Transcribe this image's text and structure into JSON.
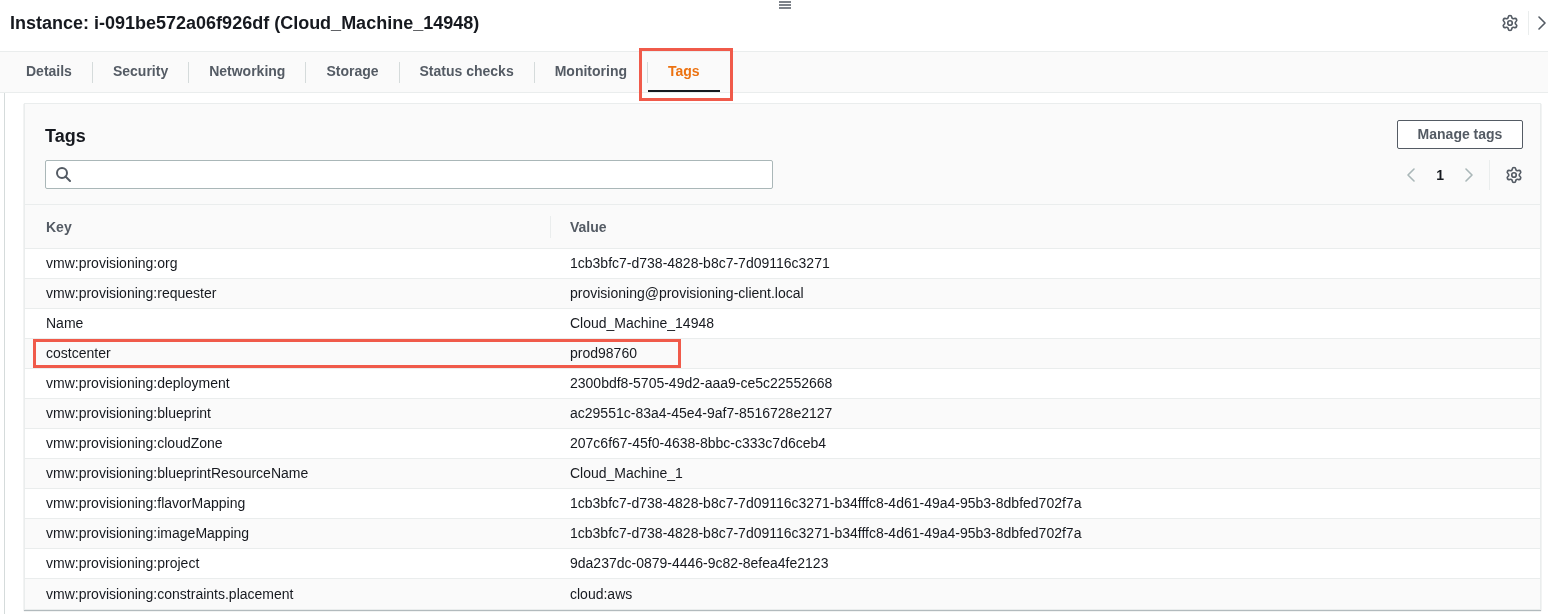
{
  "drawer": {
    "title": "Instance: i-091be572a06f926df (Cloud_Machine_14948)"
  },
  "tabs": [
    {
      "label": "Details",
      "selected": false,
      "highlighted": false
    },
    {
      "label": "Security",
      "selected": false,
      "highlighted": false
    },
    {
      "label": "Networking",
      "selected": false,
      "highlighted": false
    },
    {
      "label": "Storage",
      "selected": false,
      "highlighted": false
    },
    {
      "label": "Status checks",
      "selected": false,
      "highlighted": false
    },
    {
      "label": "Monitoring",
      "selected": false,
      "highlighted": false
    },
    {
      "label": "Tags",
      "selected": true,
      "highlighted": true
    }
  ],
  "tags_panel": {
    "title": "Tags",
    "manage_button": "Manage tags",
    "pagination": {
      "page": "1",
      "previous_disabled": true,
      "next_disabled": true
    },
    "table": {
      "columns": [
        "Key",
        "Value"
      ],
      "rows": [
        {
          "key": "vmw:provisioning:org",
          "value": "1cb3bfc7-d738-4828-b8c7-7d09116c3271",
          "highlighted": false
        },
        {
          "key": "vmw:provisioning:requester",
          "value": "provisioning@provisioning-client.local",
          "highlighted": false
        },
        {
          "key": "Name",
          "value": "Cloud_Machine_14948",
          "highlighted": false
        },
        {
          "key": "costcenter",
          "value": "prod98760",
          "highlighted": true
        },
        {
          "key": "vmw:provisioning:deployment",
          "value": "2300bdf8-5705-49d2-aaa9-ce5c22552668",
          "highlighted": false
        },
        {
          "key": "vmw:provisioning:blueprint",
          "value": "ac29551c-83a4-45e4-9af7-8516728e2127",
          "highlighted": false
        },
        {
          "key": "vmw:provisioning:cloudZone",
          "value": "207c6f67-45f0-4638-8bbc-c333c7d6ceb4",
          "highlighted": false
        },
        {
          "key": "vmw:provisioning:blueprintResourceName",
          "value": "Cloud_Machine_1",
          "highlighted": false
        },
        {
          "key": "vmw:provisioning:flavorMapping",
          "value": "1cb3bfc7-d738-4828-b8c7-7d09116c3271-b34fffc8-4d61-49a4-95b3-8dbfed702f7a",
          "highlighted": false
        },
        {
          "key": "vmw:provisioning:imageMapping",
          "value": "1cb3bfc7-d738-4828-b8c7-7d09116c3271-b34fffc8-4d61-49a4-95b3-8dbfed702f7a",
          "highlighted": false
        },
        {
          "key": "vmw:provisioning:project",
          "value": "9da237dc-0879-4446-9c82-8efea4fe2123",
          "highlighted": false
        },
        {
          "key": "vmw:provisioning:constraints.placement",
          "value": "cloud:aws",
          "highlighted": false
        }
      ]
    }
  }
}
